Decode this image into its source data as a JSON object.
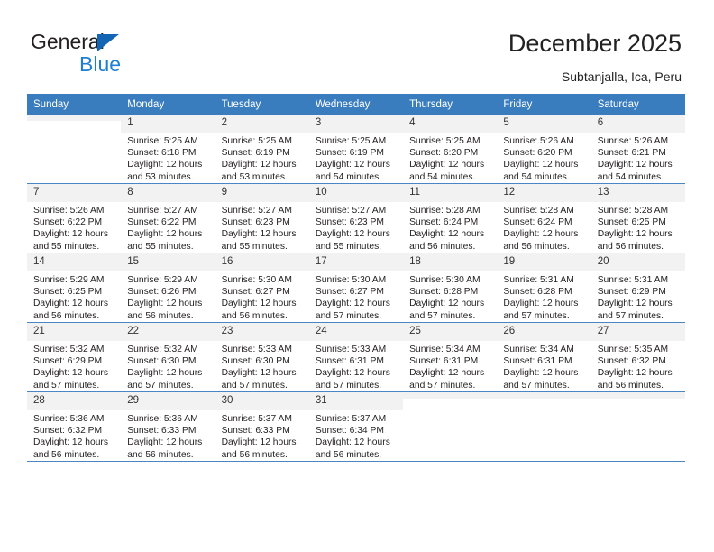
{
  "brand": {
    "name_part1": "General",
    "name_part2": "Blue",
    "triangle_color": "#1565b5",
    "blue_color": "#1f7fd4"
  },
  "header": {
    "title": "December 2025",
    "subtitle": "Subtanjalla, Ica, Peru",
    "header_bg": "#3a7dbf"
  },
  "calendar": {
    "weekday_headers": [
      "Sunday",
      "Monday",
      "Tuesday",
      "Wednesday",
      "Thursday",
      "Friday",
      "Saturday"
    ],
    "weeks": [
      [
        {
          "day": "",
          "sunrise": "",
          "sunset": "",
          "daylight1": "",
          "daylight2": ""
        },
        {
          "day": "1",
          "sunrise": "Sunrise: 5:25 AM",
          "sunset": "Sunset: 6:18 PM",
          "daylight1": "Daylight: 12 hours",
          "daylight2": "and 53 minutes."
        },
        {
          "day": "2",
          "sunrise": "Sunrise: 5:25 AM",
          "sunset": "Sunset: 6:19 PM",
          "daylight1": "Daylight: 12 hours",
          "daylight2": "and 53 minutes."
        },
        {
          "day": "3",
          "sunrise": "Sunrise: 5:25 AM",
          "sunset": "Sunset: 6:19 PM",
          "daylight1": "Daylight: 12 hours",
          "daylight2": "and 54 minutes."
        },
        {
          "day": "4",
          "sunrise": "Sunrise: 5:25 AM",
          "sunset": "Sunset: 6:20 PM",
          "daylight1": "Daylight: 12 hours",
          "daylight2": "and 54 minutes."
        },
        {
          "day": "5",
          "sunrise": "Sunrise: 5:26 AM",
          "sunset": "Sunset: 6:20 PM",
          "daylight1": "Daylight: 12 hours",
          "daylight2": "and 54 minutes."
        },
        {
          "day": "6",
          "sunrise": "Sunrise: 5:26 AM",
          "sunset": "Sunset: 6:21 PM",
          "daylight1": "Daylight: 12 hours",
          "daylight2": "and 54 minutes."
        }
      ],
      [
        {
          "day": "7",
          "sunrise": "Sunrise: 5:26 AM",
          "sunset": "Sunset: 6:22 PM",
          "daylight1": "Daylight: 12 hours",
          "daylight2": "and 55 minutes."
        },
        {
          "day": "8",
          "sunrise": "Sunrise: 5:27 AM",
          "sunset": "Sunset: 6:22 PM",
          "daylight1": "Daylight: 12 hours",
          "daylight2": "and 55 minutes."
        },
        {
          "day": "9",
          "sunrise": "Sunrise: 5:27 AM",
          "sunset": "Sunset: 6:23 PM",
          "daylight1": "Daylight: 12 hours",
          "daylight2": "and 55 minutes."
        },
        {
          "day": "10",
          "sunrise": "Sunrise: 5:27 AM",
          "sunset": "Sunset: 6:23 PM",
          "daylight1": "Daylight: 12 hours",
          "daylight2": "and 55 minutes."
        },
        {
          "day": "11",
          "sunrise": "Sunrise: 5:28 AM",
          "sunset": "Sunset: 6:24 PM",
          "daylight1": "Daylight: 12 hours",
          "daylight2": "and 56 minutes."
        },
        {
          "day": "12",
          "sunrise": "Sunrise: 5:28 AM",
          "sunset": "Sunset: 6:24 PM",
          "daylight1": "Daylight: 12 hours",
          "daylight2": "and 56 minutes."
        },
        {
          "day": "13",
          "sunrise": "Sunrise: 5:28 AM",
          "sunset": "Sunset: 6:25 PM",
          "daylight1": "Daylight: 12 hours",
          "daylight2": "and 56 minutes."
        }
      ],
      [
        {
          "day": "14",
          "sunrise": "Sunrise: 5:29 AM",
          "sunset": "Sunset: 6:25 PM",
          "daylight1": "Daylight: 12 hours",
          "daylight2": "and 56 minutes."
        },
        {
          "day": "15",
          "sunrise": "Sunrise: 5:29 AM",
          "sunset": "Sunset: 6:26 PM",
          "daylight1": "Daylight: 12 hours",
          "daylight2": "and 56 minutes."
        },
        {
          "day": "16",
          "sunrise": "Sunrise: 5:30 AM",
          "sunset": "Sunset: 6:27 PM",
          "daylight1": "Daylight: 12 hours",
          "daylight2": "and 56 minutes."
        },
        {
          "day": "17",
          "sunrise": "Sunrise: 5:30 AM",
          "sunset": "Sunset: 6:27 PM",
          "daylight1": "Daylight: 12 hours",
          "daylight2": "and 57 minutes."
        },
        {
          "day": "18",
          "sunrise": "Sunrise: 5:30 AM",
          "sunset": "Sunset: 6:28 PM",
          "daylight1": "Daylight: 12 hours",
          "daylight2": "and 57 minutes."
        },
        {
          "day": "19",
          "sunrise": "Sunrise: 5:31 AM",
          "sunset": "Sunset: 6:28 PM",
          "daylight1": "Daylight: 12 hours",
          "daylight2": "and 57 minutes."
        },
        {
          "day": "20",
          "sunrise": "Sunrise: 5:31 AM",
          "sunset": "Sunset: 6:29 PM",
          "daylight1": "Daylight: 12 hours",
          "daylight2": "and 57 minutes."
        }
      ],
      [
        {
          "day": "21",
          "sunrise": "Sunrise: 5:32 AM",
          "sunset": "Sunset: 6:29 PM",
          "daylight1": "Daylight: 12 hours",
          "daylight2": "and 57 minutes."
        },
        {
          "day": "22",
          "sunrise": "Sunrise: 5:32 AM",
          "sunset": "Sunset: 6:30 PM",
          "daylight1": "Daylight: 12 hours",
          "daylight2": "and 57 minutes."
        },
        {
          "day": "23",
          "sunrise": "Sunrise: 5:33 AM",
          "sunset": "Sunset: 6:30 PM",
          "daylight1": "Daylight: 12 hours",
          "daylight2": "and 57 minutes."
        },
        {
          "day": "24",
          "sunrise": "Sunrise: 5:33 AM",
          "sunset": "Sunset: 6:31 PM",
          "daylight1": "Daylight: 12 hours",
          "daylight2": "and 57 minutes."
        },
        {
          "day": "25",
          "sunrise": "Sunrise: 5:34 AM",
          "sunset": "Sunset: 6:31 PM",
          "daylight1": "Daylight: 12 hours",
          "daylight2": "and 57 minutes."
        },
        {
          "day": "26",
          "sunrise": "Sunrise: 5:34 AM",
          "sunset": "Sunset: 6:31 PM",
          "daylight1": "Daylight: 12 hours",
          "daylight2": "and 57 minutes."
        },
        {
          "day": "27",
          "sunrise": "Sunrise: 5:35 AM",
          "sunset": "Sunset: 6:32 PM",
          "daylight1": "Daylight: 12 hours",
          "daylight2": "and 56 minutes."
        }
      ],
      [
        {
          "day": "28",
          "sunrise": "Sunrise: 5:36 AM",
          "sunset": "Sunset: 6:32 PM",
          "daylight1": "Daylight: 12 hours",
          "daylight2": "and 56 minutes."
        },
        {
          "day": "29",
          "sunrise": "Sunrise: 5:36 AM",
          "sunset": "Sunset: 6:33 PM",
          "daylight1": "Daylight: 12 hours",
          "daylight2": "and 56 minutes."
        },
        {
          "day": "30",
          "sunrise": "Sunrise: 5:37 AM",
          "sunset": "Sunset: 6:33 PM",
          "daylight1": "Daylight: 12 hours",
          "daylight2": "and 56 minutes."
        },
        {
          "day": "31",
          "sunrise": "Sunrise: 5:37 AM",
          "sunset": "Sunset: 6:34 PM",
          "daylight1": "Daylight: 12 hours",
          "daylight2": "and 56 minutes."
        },
        {
          "day": "",
          "sunrise": "",
          "sunset": "",
          "daylight1": "",
          "daylight2": ""
        },
        {
          "day": "",
          "sunrise": "",
          "sunset": "",
          "daylight1": "",
          "daylight2": ""
        },
        {
          "day": "",
          "sunrise": "",
          "sunset": "",
          "daylight1": "",
          "daylight2": ""
        }
      ]
    ]
  }
}
